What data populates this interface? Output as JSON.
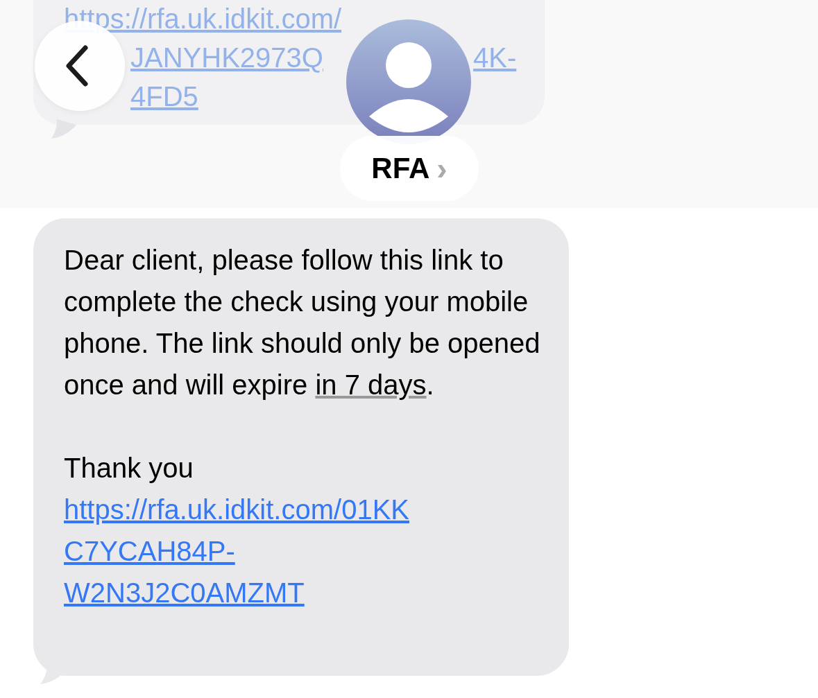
{
  "previous_message": {
    "lines": [
      "https://rfa.uk.idkit.com/",
      "JANYHK2973Q",
      "4K-",
      "4FD5"
    ]
  },
  "header": {
    "contact_name": "RFA",
    "chevron": "›"
  },
  "message": {
    "text_before": "Dear client, please follow this link to complete the check using your mobile phone. The link should only be opened once and will expire ",
    "date_link": "in 7 days",
    "text_after": ".",
    "closing": "Thank you",
    "link": "https://rfa.uk.idkit.com/01KKC7YCAH84P-W2N3J2C0AMZMT"
  }
}
